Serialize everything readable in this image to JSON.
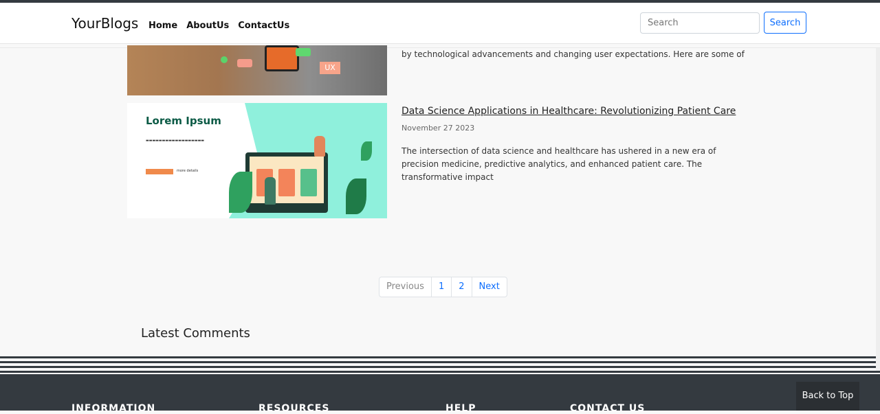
{
  "navbar": {
    "brand": "YourBlogs",
    "links": [
      "Home",
      "AboutUs",
      "ContactUs"
    ],
    "search_placeholder": "Search",
    "search_button": "Search"
  },
  "posts": [
    {
      "excerpt_tail": "by technological advancements and changing user expectations. Here are some of",
      "image_tag": "UX"
    },
    {
      "title": "Data Science Applications in Healthcare: Revolutionizing Patient Care",
      "date": "November 27 2023",
      "excerpt": "The intersection of data science and healthcare has ushered in a new era of precision medicine, predictive analytics, and enhanced patient care. The transformative impact",
      "image_heading": "Lorem Ipsum",
      "image_link": "more details"
    }
  ],
  "pagination": [
    "Previous",
    "1",
    "2",
    "Next"
  ],
  "comments": {
    "heading": "Latest Comments"
  },
  "footer": {
    "columns": [
      "INFORMATION",
      "RESOURCES",
      "HELP",
      "CONTACT US"
    ],
    "back_to_top": "Back to Top"
  },
  "colors": {
    "primary": "#0d6efd",
    "dark": "#343a40",
    "teal": "#8ff0dc"
  }
}
